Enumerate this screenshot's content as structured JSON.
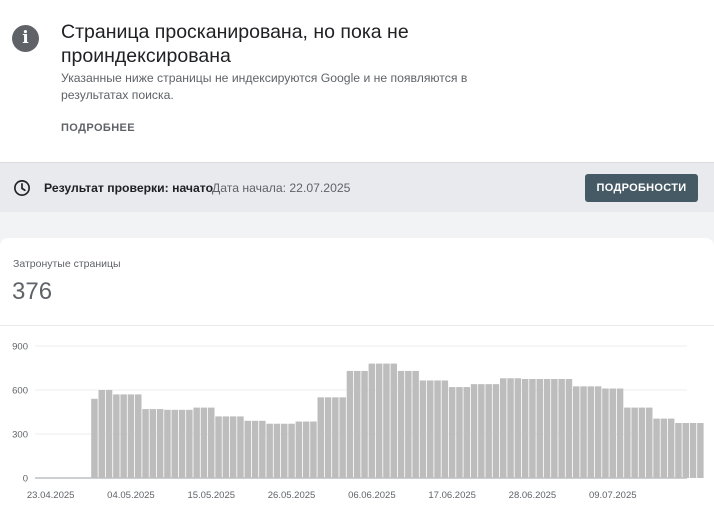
{
  "issue": {
    "title": "Страница просканирована, но пока не проиндексирована",
    "description": "Указанные ниже страницы не индексируются Google и не появляются в результатах поиска.",
    "learn_more": "ПОДРОБНЕЕ",
    "icon": "info-icon"
  },
  "validation": {
    "label": "Результат проверки: начато",
    "started": "Дата начала: 22.07.2025",
    "details_button": "ПОДРОБНОСТИ",
    "icon": "clock-icon",
    "button_color": "#455a64"
  },
  "metric": {
    "label": "Затронутые страницы",
    "value": "376"
  },
  "chart_data": {
    "type": "bar",
    "ylim": [
      0,
      900
    ],
    "yticks": [
      0,
      300,
      600,
      900
    ],
    "grid": true,
    "bar_color": "#bdbdbd",
    "x_tick_labels": [
      "23.04.2025",
      "04.05.2025",
      "15.05.2025",
      "26.05.2025",
      "06.06.2025",
      "17.06.2025",
      "28.06.2025",
      "09.07.2025"
    ],
    "x_tick_indices": [
      0,
      11,
      22,
      33,
      44,
      55,
      66,
      77
    ],
    "start_index": 6,
    "values": [
      0,
      0,
      0,
      0,
      0,
      0,
      540,
      600,
      600,
      570,
      570,
      570,
      570,
      470,
      470,
      470,
      465,
      465,
      465,
      465,
      480,
      480,
      480,
      420,
      420,
      420,
      420,
      390,
      390,
      390,
      370,
      370,
      370,
      370,
      385,
      385,
      385,
      550,
      550,
      550,
      550,
      730,
      730,
      730,
      780,
      780,
      780,
      780,
      730,
      730,
      730,
      665,
      665,
      665,
      665,
      620,
      620,
      620,
      640,
      640,
      640,
      640,
      680,
      680,
      680,
      675,
      675,
      675,
      675,
      675,
      675,
      675,
      625,
      625,
      625,
      625,
      610,
      610,
      610,
      480,
      480,
      480,
      480,
      405,
      405,
      405,
      375,
      375,
      375,
      375
    ]
  }
}
